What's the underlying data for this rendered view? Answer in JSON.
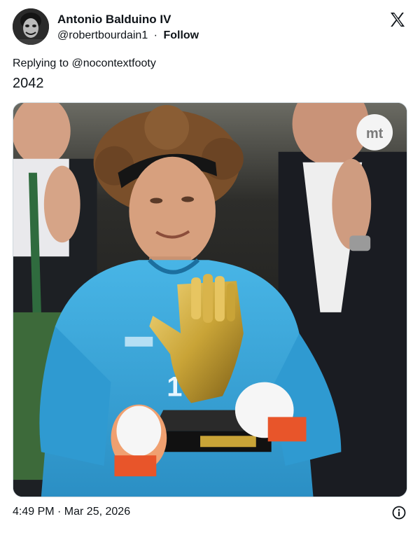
{
  "author": {
    "name": "Antonio Balduino IV",
    "handle": "@robertbourdain1",
    "separator": "·",
    "follow_label": "Follow"
  },
  "reply": {
    "prefix": "Replying to ",
    "mention": "@nocontextfooty"
  },
  "tweet": {
    "text": "2042"
  },
  "media": {
    "watermark": "mt"
  },
  "footer": {
    "timestamp": "4:49 PM · Mar 25, 2026"
  },
  "icons": {
    "brand": "x-logo-icon",
    "info": "info-icon"
  },
  "colors": {
    "text": "#0f1419",
    "jersey": "#3aa7db",
    "trophy": "#c9a437"
  }
}
